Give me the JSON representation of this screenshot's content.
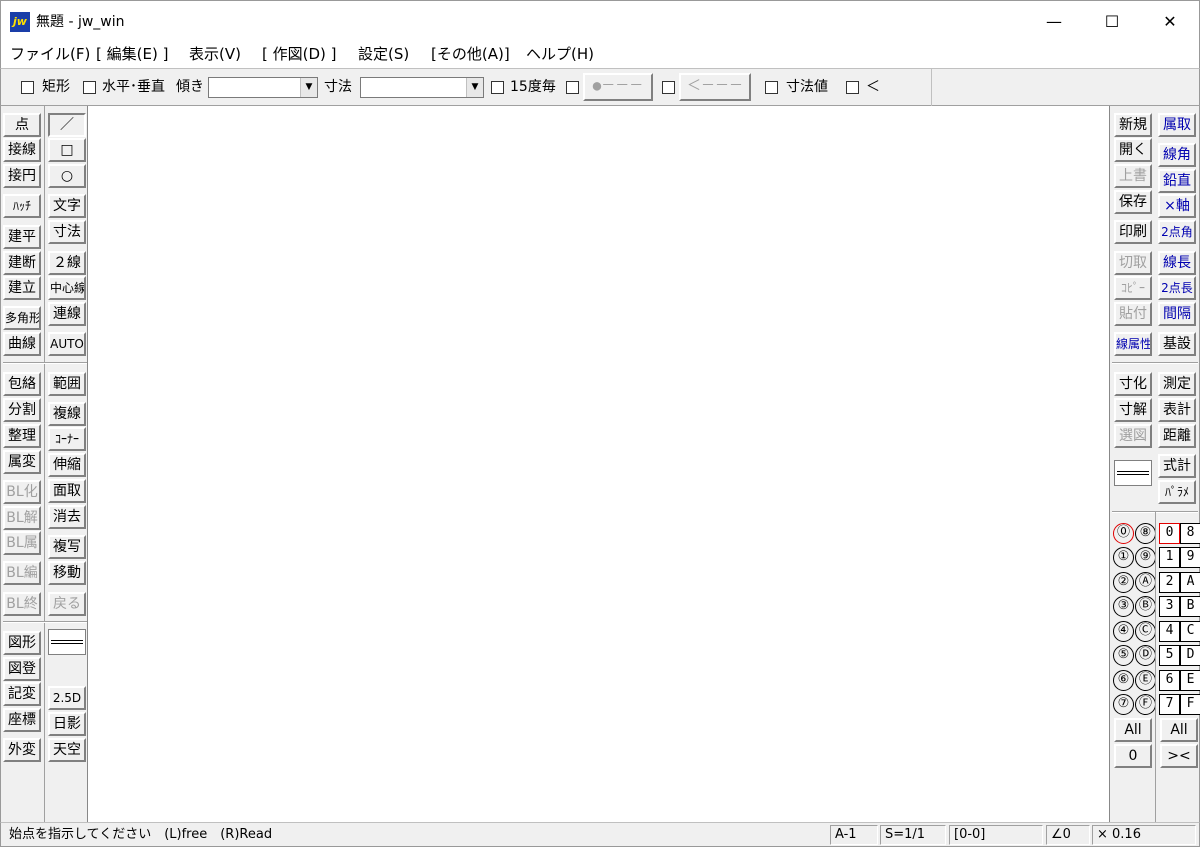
{
  "window": {
    "icon_text": "jw",
    "title": "無題 - jw_win",
    "minimize": "—",
    "maximize": "☐",
    "close": "✕"
  },
  "menu": [
    "ファイル(F)",
    "[ 編集(E) ]",
    "表示(V)",
    "[ 作図(D) ]",
    "設定(S)",
    "[その他(A)]",
    "ヘルプ(H)"
  ],
  "toolbar": {
    "rect_label": "矩形",
    "hv_label": "水平･垂直",
    "tilt_label": "傾き",
    "tilt_value": "",
    "dim_label": "寸法",
    "dim_value": "",
    "deg15_label": "15度毎",
    "btn_dot": "●－－－",
    "btn_arrow": "＜－－－",
    "dimval_label": "寸法値",
    "lt_label": "＜",
    "dropdown_arrow": "▼"
  },
  "left_col1": [
    "点",
    "接線",
    "接円",
    "ﾊｯﾁ",
    "建平",
    "建断",
    "建立",
    "多角形",
    "曲線",
    "包絡",
    "分割",
    "整理",
    "属変",
    "BL化",
    "BL解",
    "BL属",
    "BL編",
    "BL終",
    "図形",
    "図登",
    "記変",
    "座標",
    "外変"
  ],
  "left_col2": [
    "／",
    "□",
    "○",
    "文字",
    "寸法",
    "２線",
    "中心線",
    "連線",
    "AUTO",
    "範囲",
    "複線",
    "ｺｰﾅｰ",
    "伸縮",
    "面取",
    "消去",
    "複写",
    "移動",
    "戻る",
    "2.5D",
    "日影",
    "天空"
  ],
  "right_col1": [
    "新規",
    "開く",
    "上書",
    "保存",
    "印刷",
    "切取",
    "ｺﾋﾟｰ",
    "貼付",
    "線属性",
    "寸化",
    "寸解",
    "選図"
  ],
  "right_col2": [
    "属取",
    "線角",
    "鉛直",
    "×軸",
    "2点角",
    "線長",
    "2点長",
    "間隔",
    "基設",
    "測定",
    "表計",
    "距離",
    "式計",
    "ﾊﾟﾗﾒ"
  ],
  "layer_groups": [
    "⓪",
    "⑧",
    "①",
    "⑨",
    "②",
    "Ⓐ",
    "③",
    "Ⓑ",
    "④",
    "Ⓒ",
    "⑤",
    "Ⓓ",
    "⑥",
    "Ⓔ",
    "⑦",
    "Ⓕ"
  ],
  "layers": [
    "0",
    "8",
    "1",
    "9",
    "2",
    "A",
    "3",
    "B",
    "4",
    "C",
    "5",
    "D",
    "6",
    "E",
    "7",
    "F"
  ],
  "layer_all_left": "All",
  "layer_zero": "0",
  "layer_all_right": "All",
  "layer_x": "><",
  "status": {
    "message": "始点を指示してください　(L)free　(R)Read",
    "paper": "A-1",
    "scale": "S=1/1",
    "layer": "[0-0]",
    "angle": "∠0",
    "factor": "× 0.16"
  }
}
